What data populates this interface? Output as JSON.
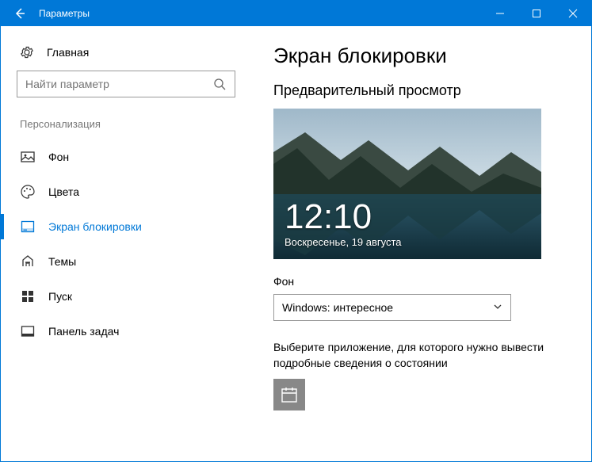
{
  "titlebar": {
    "title": "Параметры"
  },
  "sidebar": {
    "home": "Главная",
    "search_placeholder": "Найти параметр",
    "category": "Персонализация",
    "items": [
      {
        "label": "Фон"
      },
      {
        "label": "Цвета"
      },
      {
        "label": "Экран блокировки"
      },
      {
        "label": "Темы"
      },
      {
        "label": "Пуск"
      },
      {
        "label": "Панель задач"
      }
    ]
  },
  "main": {
    "heading": "Экран блокировки",
    "preview_label": "Предварительный просмотр",
    "preview_time": "12:10",
    "preview_date": "Воскресенье, 19 августа",
    "bg_label": "Фон",
    "bg_value": "Windows: интересное",
    "app_hint": "Выберите приложение, для которого нужно вывести подробные сведения о состоянии"
  }
}
